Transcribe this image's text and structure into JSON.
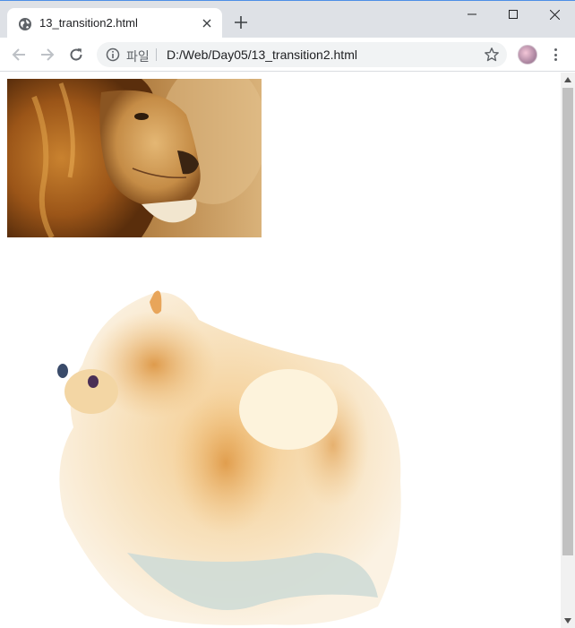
{
  "tab": {
    "title": "13_transition2.html",
    "favicon": "globe-icon",
    "close_icon": "close-icon"
  },
  "newtab_icon": "plus-icon",
  "window_controls": [
    "minimize-icon",
    "maximize-icon",
    "close-icon"
  ],
  "toolbar": {
    "back_icon": "arrow-left-icon",
    "forward_icon": "arrow-right-icon",
    "reload_icon": "reload-icon",
    "info_icon": "info-icon",
    "scheme_label": "파일",
    "url": "D:/Web/Day05/13_transition2.html",
    "bookmark_icon": "star-icon",
    "menu_icon": "kebab-menu-icon"
  },
  "content": {
    "images": [
      {
        "name": "lion-image",
        "subject": "lion"
      },
      {
        "name": "dog-image",
        "subject": "pomeranian dog watercolor"
      }
    ]
  },
  "colors": {
    "tabstrip_bg": "#dee1e6",
    "omnibox_bg": "#f1f3f4",
    "scrollbar_thumb": "#c1c1c1"
  }
}
